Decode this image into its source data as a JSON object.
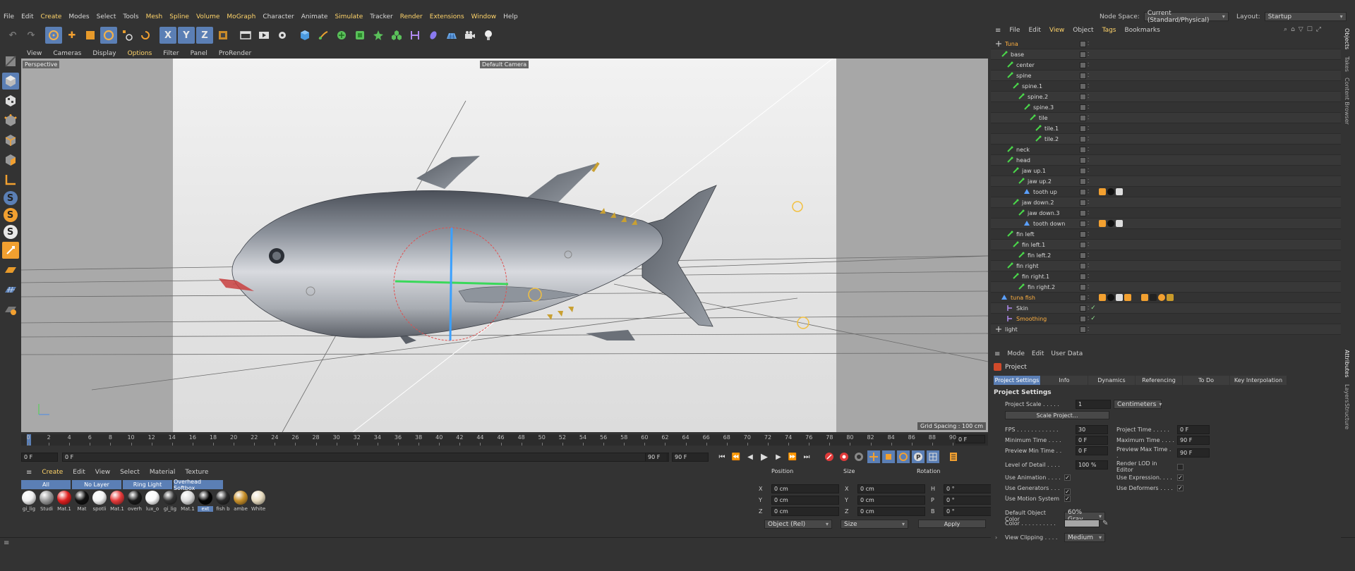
{
  "menu": [
    "File",
    "Edit",
    "Create",
    "Modes",
    "Select",
    "Tools",
    "Mesh",
    "Spline",
    "Volume",
    "MoGraph",
    "Character",
    "Animate",
    "Simulate",
    "Tracker",
    "Render",
    "Extensions",
    "Window",
    "Help"
  ],
  "node_space": {
    "label": "Node Space:",
    "value": "Current (Standard/Physical)"
  },
  "layout": {
    "label": "Layout:",
    "value": "Startup"
  },
  "toolbar": {
    "x_label": "X",
    "y_label": "Y",
    "z_label": "Z"
  },
  "left_toolbar": {
    "s1": "S",
    "s2": "S",
    "s3": "S"
  },
  "viewport_menu": [
    "View",
    "Cameras",
    "Display",
    "Options",
    "Filter",
    "Panel",
    "ProRender"
  ],
  "viewport": {
    "label": "Perspective",
    "camera": "Default Camera",
    "grid": "Grid Spacing : 100 cm"
  },
  "timeline": {
    "ticks": [
      "0",
      "2",
      "4",
      "6",
      "8",
      "10",
      "12",
      "14",
      "16",
      "18",
      "20",
      "22",
      "24",
      "26",
      "28",
      "30",
      "32",
      "34",
      "36",
      "38",
      "40",
      "42",
      "44",
      "46",
      "48",
      "50",
      "52",
      "54",
      "56",
      "58",
      "60",
      "62",
      "64",
      "66",
      "68",
      "70",
      "72",
      "74",
      "76",
      "78",
      "80",
      "82",
      "84",
      "86",
      "88",
      "90"
    ],
    "current": "0 F"
  },
  "playback": {
    "start": "0 F",
    "current": "0 F",
    "end": "90 F",
    "max": "90 F"
  },
  "material_menu": [
    "Create",
    "Edit",
    "View",
    "Select",
    "Material",
    "Texture"
  ],
  "material_tabs": [
    "All",
    "No Layer",
    "Ring Light",
    "Overhead Softbox"
  ],
  "materials": [
    {
      "label": "gi_lig",
      "color": "#f0f0f0"
    },
    {
      "label": "Studi",
      "color": "#9a9a9a"
    },
    {
      "label": "Mat.1",
      "color": "#e02020"
    },
    {
      "label": "Mat",
      "color": "#111111"
    },
    {
      "label": "spotli",
      "color": "#f4f4f4"
    },
    {
      "label": "Mat.1",
      "color": "#e63a3a"
    },
    {
      "label": "overh",
      "color": "#1a1a1a"
    },
    {
      "label": "lux_o",
      "color": "#fafafa"
    },
    {
      "label": "gi_lig",
      "color": "#333333"
    },
    {
      "label": "Mat.1",
      "color": "#dcdcdc"
    },
    {
      "label": "ext",
      "color": "#050505"
    },
    {
      "label": "fish b",
      "color": "#2a2a2a"
    },
    {
      "label": "ambe",
      "color": "#c8902a"
    },
    {
      "label": "White",
      "color": "#e8dcc0"
    }
  ],
  "coords": {
    "headers": {
      "position": "Position",
      "size": "Size",
      "rotation": "Rotation"
    },
    "rows": [
      {
        "p_label": "X",
        "p_val": "0 cm",
        "s_label": "X",
        "s_val": "0 cm",
        "r_label": "H",
        "r_val": "0 °"
      },
      {
        "p_label": "Y",
        "p_val": "0 cm",
        "s_label": "Y",
        "s_val": "0 cm",
        "r_label": "P",
        "r_val": "0 °"
      },
      {
        "p_label": "Z",
        "p_val": "0 cm",
        "s_label": "Z",
        "s_val": "0 cm",
        "r_label": "B",
        "r_val": "0 °"
      }
    ],
    "mode": "Object (Rel)",
    "size_mode": "Size",
    "apply": "Apply"
  },
  "object_menu": [
    "File",
    "Edit",
    "View",
    "Object",
    "Tags",
    "Bookmarks"
  ],
  "objects": [
    {
      "name": "Tuna",
      "indent": 0,
      "hl": true,
      "icon": "null",
      "tags": 0
    },
    {
      "name": "base",
      "indent": 1,
      "hl": false,
      "icon": "joint",
      "tags": 0
    },
    {
      "name": "center",
      "indent": 2,
      "hl": false,
      "icon": "joint",
      "tags": 0
    },
    {
      "name": "spine",
      "indent": 2,
      "hl": false,
      "icon": "joint",
      "tags": 0
    },
    {
      "name": "spine.1",
      "indent": 3,
      "hl": false,
      "icon": "joint",
      "tags": 0
    },
    {
      "name": "spine.2",
      "indent": 4,
      "hl": false,
      "icon": "joint",
      "tags": 0
    },
    {
      "name": "spine.3",
      "indent": 5,
      "hl": false,
      "icon": "joint",
      "tags": 0
    },
    {
      "name": "tile",
      "indent": 6,
      "hl": false,
      "icon": "joint",
      "tags": 0
    },
    {
      "name": "tile.1",
      "indent": 7,
      "hl": false,
      "icon": "joint",
      "tags": 0
    },
    {
      "name": "tile.2",
      "indent": 7,
      "hl": false,
      "icon": "joint",
      "tags": 0
    },
    {
      "name": "neck",
      "indent": 2,
      "hl": false,
      "icon": "joint",
      "tags": 0
    },
    {
      "name": "head",
      "indent": 2,
      "hl": false,
      "icon": "joint",
      "tags": 0
    },
    {
      "name": "jaw up.1",
      "indent": 3,
      "hl": false,
      "icon": "joint",
      "tags": 0
    },
    {
      "name": "jaw up.2",
      "indent": 4,
      "hl": false,
      "icon": "joint",
      "tags": 0
    },
    {
      "name": "tooth up",
      "indent": 5,
      "hl": false,
      "icon": "poly",
      "tags": 3
    },
    {
      "name": "jaw down.2",
      "indent": 3,
      "hl": false,
      "icon": "joint",
      "tags": 0
    },
    {
      "name": "jaw down.3",
      "indent": 4,
      "hl": false,
      "icon": "joint",
      "tags": 0
    },
    {
      "name": "tooth down",
      "indent": 5,
      "hl": false,
      "icon": "poly",
      "tags": 3
    },
    {
      "name": "fin left",
      "indent": 2,
      "hl": false,
      "icon": "joint",
      "tags": 0
    },
    {
      "name": "fin left.1",
      "indent": 3,
      "hl": false,
      "icon": "joint",
      "tags": 0
    },
    {
      "name": "fin left.2",
      "indent": 4,
      "hl": false,
      "icon": "joint",
      "tags": 0
    },
    {
      "name": "fin right",
      "indent": 2,
      "hl": false,
      "icon": "joint",
      "tags": 0
    },
    {
      "name": "fin right.1",
      "indent": 3,
      "hl": false,
      "icon": "joint",
      "tags": 0
    },
    {
      "name": "fin right.2",
      "indent": 4,
      "hl": false,
      "icon": "joint",
      "tags": 0
    },
    {
      "name": "tuna fish",
      "indent": 1,
      "hl": true,
      "icon": "poly",
      "tags": 9
    },
    {
      "name": "Skin",
      "indent": 2,
      "hl": false,
      "icon": "deformer",
      "tags": 0,
      "check": true
    },
    {
      "name": "Smoothing",
      "indent": 2,
      "hl": true,
      "icon": "deformer",
      "tags": 0,
      "check": true
    },
    {
      "name": "light",
      "indent": 0,
      "hl": false,
      "icon": "null",
      "tags": 0
    }
  ],
  "attr_menu": [
    "Mode",
    "Edit",
    "User Data"
  ],
  "attr_title": "Project",
  "attr_tabs": [
    "Project Settings",
    "Info",
    "Dynamics",
    "Referencing",
    "To Do",
    "Key Interpolation"
  ],
  "attr_section": "Project Settings",
  "attrs": {
    "project_scale": {
      "label": "Project Scale . . . . .",
      "value": "1",
      "unit": "Centimeters"
    },
    "scale_button": "Scale Project...",
    "fps": {
      "label": "FPS . . . . . . . . . . . .",
      "value": "30"
    },
    "project_time": {
      "label": "Project Time . . . . .",
      "value": "0 F"
    },
    "min_time": {
      "label": "Minimum Time . . . .",
      "value": "0 F"
    },
    "max_time": {
      "label": "Maximum Time . . . .",
      "value": "90 F"
    },
    "preview_min": {
      "label": "Preview Min Time . .",
      "value": "0 F"
    },
    "preview_max": {
      "label": "Preview Max Time . .",
      "value": "90 F"
    },
    "lod": {
      "label": "Level of Detail . . . .",
      "value": "100 %"
    },
    "render_lod": "Render LOD in Editor",
    "use_animation": "Use Animation . . . .",
    "use_expression": "Use Expression. . . .",
    "use_generators": "Use Generators . . . .",
    "use_deformers": "Use Deformers . . . .",
    "use_motion": "Use Motion System",
    "default_color": {
      "label": "Default Object Color",
      "value": "60% Gray"
    },
    "color": {
      "label": "Color . . . . . . . . . .",
      "swatch": "#a6a6a6"
    },
    "view_clipping": {
      "label": "View Clipping . . . .",
      "value": "Medium"
    }
  },
  "side_tabs_top": [
    "Objects",
    "Takes",
    "Content Browser"
  ],
  "side_tabs_bottom": [
    "Attributes",
    "Layers",
    "Structure"
  ],
  "accent": "#5b7fb5",
  "highlight": "#ffd46a"
}
